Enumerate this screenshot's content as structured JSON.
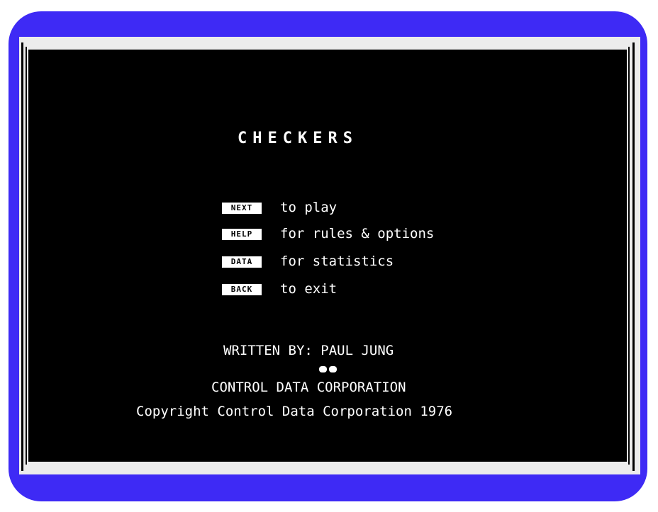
{
  "screen": {
    "title": "CHECKERS",
    "options": [
      {
        "key": "NEXT",
        "text": "to play"
      },
      {
        "key": "HELP",
        "text": "for rules & options"
      },
      {
        "key": "DATA",
        "text": "for statistics"
      },
      {
        "key": "BACK",
        "text": "to exit"
      }
    ],
    "credits": {
      "written_by": "WRITTEN BY: PAUL JUNG",
      "logo_label": "CDC",
      "company": "CONTROL DATA CORPORATION",
      "copyright": "Copyright Control Data Corporation 1976"
    }
  },
  "colors": {
    "frame": "#3e2af5",
    "screen": "#000000",
    "text": "#ffffff"
  }
}
